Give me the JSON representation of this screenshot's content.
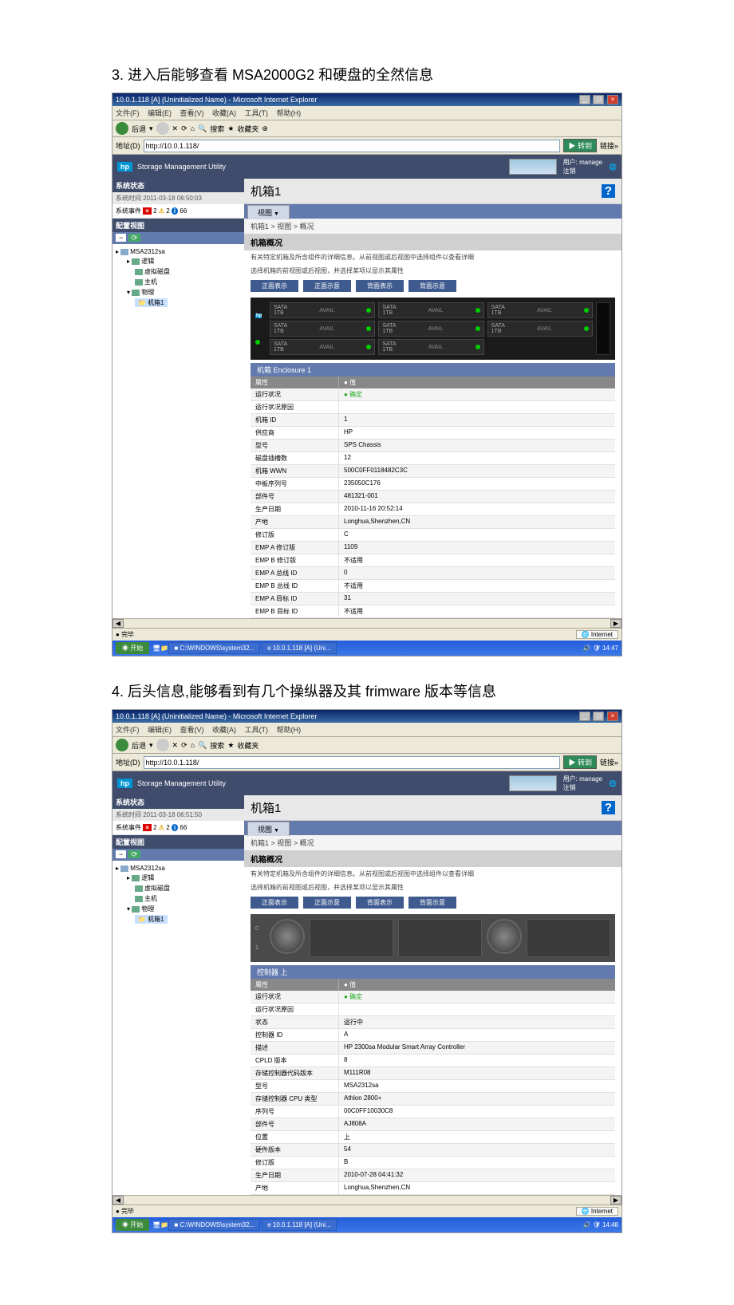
{
  "captions": {
    "c3": "3. 进入后能够查看 MSA2000G2 和硬盘的全然信息",
    "c4": "4. 后头信息,能够看到有几个操纵器及其 frimware 版本等信息"
  },
  "win": {
    "title": "10.0.1.118 [A] (Uninitialized Name) - Microsoft Internet Explorer",
    "menus": [
      "文件(F)",
      "编辑(E)",
      "查看(V)",
      "收藏(A)",
      "工具(T)",
      "帮助(H)"
    ],
    "tb": {
      "back": "后退",
      "search": "搜索",
      "fav": "收藏夹"
    },
    "addr": {
      "label": "地址(D)",
      "url": "http://10.0.1.118/",
      "go": "转到",
      "links": "链接"
    },
    "hp": {
      "title": "Storage Management Utility",
      "user_lbl": "用户:",
      "user": "manage",
      "logout": "注销"
    },
    "status": {
      "done": "完毕",
      "zone": "Internet"
    },
    "task": {
      "start": "开始",
      "t1": "C:\\WINDOWS\\system32...",
      "t2": "10.0.1.118 [A] (Uni..."
    }
  },
  "s1": {
    "side": {
      "h": "系统状态",
      "time": "系统时间 2011-03-18 06:50:03",
      "ev": "系统事件",
      "e": "2",
      "w": "2",
      "i": "66",
      "cfg": "配置视图"
    },
    "tree": {
      "root": "MSA2312sa",
      "logic": "逻辑",
      "vd": "虚拟磁盘",
      "host": "主机",
      "phys": "物理",
      "encl": "机箱1"
    },
    "main": {
      "h1": "机箱1",
      "tab": "视图",
      "crumb": "机箱1 > 视图 > 概况",
      "sect": "机箱概况",
      "d1": "有关特定机箱及所含组件的详细信息。从前视图或后视图中选择组件以查看详细",
      "d2": "选择机箱的前视图或后视图，并选择某项以显示其属性",
      "vb": [
        "正面表示",
        "正面示意",
        "背面表示",
        "背面示意"
      ],
      "ph": "机箱 Enclosure 1",
      "col1": "属性",
      "col2": "值",
      "rows": [
        [
          "运行状况",
          "● 确定"
        ],
        [
          "运行状况原因",
          ""
        ],
        [
          "机箱 ID",
          "1"
        ],
        [
          "供应商",
          "HP"
        ],
        [
          "型号",
          "SPS Chassis"
        ],
        [
          "磁盘插槽数",
          "12"
        ],
        [
          "机箱 WWN",
          "500C0FF0118482C3C"
        ],
        [
          "中板序列号",
          "235050C176"
        ],
        [
          "部件号",
          "481321-001"
        ],
        [
          "生产日期",
          "2010-11-16 20:52:14"
        ],
        [
          "产地",
          "Longhua,Shenzhen,CN"
        ],
        [
          "修订版",
          "C"
        ],
        [
          "EMP A 修订版",
          "1109"
        ],
        [
          "EMP B 修订版",
          "不适用"
        ],
        [
          "EMP A 总线 ID",
          "0"
        ],
        [
          "EMP B 总线 ID",
          "不适用"
        ],
        [
          "EMP A 目标 ID",
          "31"
        ],
        [
          "EMP B 目标 ID",
          "不适用"
        ]
      ]
    },
    "clock": "14:47"
  },
  "s2": {
    "side": {
      "h": "系统状态",
      "time": "系统时间 2011-03-18 06:51:50",
      "ev": "系统事件",
      "e": "2",
      "w": "2",
      "i": "66",
      "cfg": "配置视图"
    },
    "tree": {
      "root": "MSA2312sa",
      "logic": "逻辑",
      "vd": "虚拟磁盘",
      "host": "主机",
      "phys": "物理",
      "encl": "机箱1"
    },
    "main": {
      "h1": "机箱1",
      "tab": "视图",
      "crumb": "机箱1 > 视图 > 概况",
      "sect": "机箱概况",
      "d1": "有关特定机箱及所含组件的详细信息。从前视图或后视图中选择组件以查看详细",
      "d2": "选择机箱的前视图或后视图，并选择某项以显示其属性",
      "vb": [
        "正面表示",
        "正面示意",
        "背面表示",
        "背面示意"
      ],
      "ph": "控制器 上",
      "col1": "属性",
      "col2": "值",
      "rows": [
        [
          "运行状况",
          "● 确定"
        ],
        [
          "运行状况原因",
          ""
        ],
        [
          "状态",
          "运行中"
        ],
        [
          "控制器 ID",
          "A"
        ],
        [
          "描述",
          "HP 2300sa Modular Smart Array Controller"
        ],
        [
          "CPLD 版本",
          "8"
        ],
        [
          "存储控制器代码版本",
          "M111R08"
        ],
        [
          "型号",
          "MSA2312sa"
        ],
        [
          "存储控制器 CPU 类型",
          "Athlon 2800+"
        ],
        [
          "序列号",
          "00C0FF10030C8"
        ],
        [
          "部件号",
          "AJ808A"
        ],
        [
          "位置",
          "上"
        ],
        [
          "硬件版本",
          "54"
        ],
        [
          "修订版",
          "B"
        ],
        [
          "生产日期",
          "2010-07-28 04:41:32"
        ],
        [
          "产地",
          "Longhua,Shenzhen,CN"
        ]
      ]
    },
    "clock": "14:48"
  },
  "drive": {
    "sata": "SATA",
    "cap": "1TB",
    "avail": "AVAIL"
  }
}
